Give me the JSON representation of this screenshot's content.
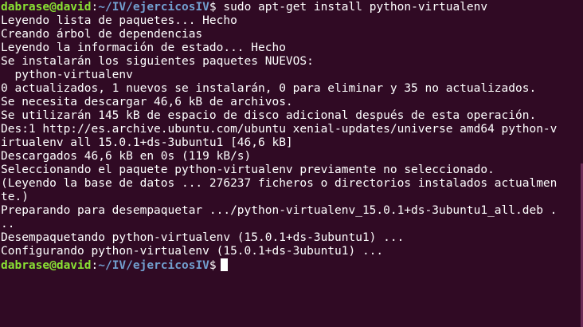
{
  "colors": {
    "background": "#300a24",
    "text": "#ffffff",
    "user_host": "#8ae234",
    "path": "#729fcf"
  },
  "prompt1": {
    "user_host": "dabrase@david",
    "separator": ":",
    "path": "~/IV/ejercicosIV",
    "symbol": "$ ",
    "command": "sudo apt-get install python-virtualenv"
  },
  "output": [
    "Leyendo lista de paquetes... Hecho",
    "Creando árbol de dependencias",
    "Leyendo la información de estado... Hecho",
    "Se instalarán los siguientes paquetes NUEVOS:",
    "  python-virtualenv",
    "0 actualizados, 1 nuevos se instalarán, 0 para eliminar y 35 no actualizados.",
    "Se necesita descargar 46,6 kB de archivos.",
    "Se utilizarán 145 kB de espacio de disco adicional después de esta operación.",
    "Des:1 http://es.archive.ubuntu.com/ubuntu xenial-updates/universe amd64 python-v",
    "irtualenv all 15.0.1+ds-3ubuntu1 [46,6 kB]",
    "Descargados 46,6 kB en 0s (119 kB/s)",
    "Seleccionando el paquete python-virtualenv previamente no seleccionado.",
    "(Leyendo la base de datos ... 276237 ficheros o directorios instalados actualmen",
    "te.)",
    "Preparando para desempaquetar .../python-virtualenv_15.0.1+ds-3ubuntu1_all.deb .",
    "..",
    "Desempaquetando python-virtualenv (15.0.1+ds-3ubuntu1) ...",
    "Configurando python-virtualenv (15.0.1+ds-3ubuntu1) ..."
  ],
  "prompt2": {
    "user_host": "dabrase@david",
    "separator": ":",
    "path": "~/IV/ejercicosIV",
    "symbol": "$"
  }
}
